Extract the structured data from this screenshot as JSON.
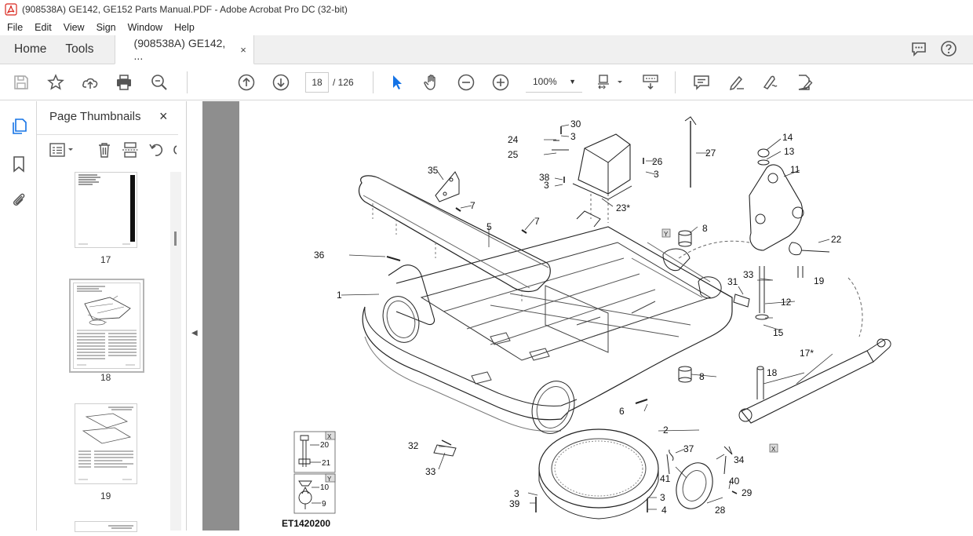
{
  "window": {
    "title": "(908538A) GE142, GE152 Parts Manual.PDF - Adobe Acrobat Pro DC (32-bit)"
  },
  "menu": [
    "File",
    "Edit",
    "View",
    "Sign",
    "Window",
    "Help"
  ],
  "tabs": {
    "home": "Home",
    "tools": "Tools",
    "document": "(908538A) GE142, ...",
    "close": "×"
  },
  "toolbar": {
    "current_page": "18",
    "page_total": "/ 126",
    "zoom": "100%"
  },
  "thumbnails_panel": {
    "title": "Page Thumbnails",
    "close": "×",
    "pages": [
      {
        "label": "17"
      },
      {
        "label": "18"
      },
      {
        "label": "19"
      }
    ]
  },
  "drawing": {
    "figure_id": "ET1420200",
    "callouts": [
      "30",
      "3",
      "24",
      "25",
      "26",
      "3",
      "27",
      "14",
      "13",
      "11",
      "38",
      "3",
      "35",
      "7",
      "23*",
      "7",
      "5",
      "8",
      "36",
      "1",
      "22",
      "33",
      "31",
      "19",
      "12",
      "15",
      "17*",
      "18",
      "8",
      "6",
      "2",
      "32",
      "33",
      "37",
      "34",
      "41",
      "40",
      "29",
      "3",
      "39",
      "3",
      "4",
      "28"
    ],
    "legend_x": {
      "tag": "X",
      "items": [
        "20",
        "21"
      ]
    },
    "legend_y": {
      "tag": "Y",
      "items": [
        "10",
        "9"
      ]
    },
    "marker_x": "X",
    "marker_y": "Y"
  },
  "colors": {
    "accent": "#1473e6",
    "acrobat_red": "#d9251c",
    "doc_background": "#8e8e8e"
  }
}
